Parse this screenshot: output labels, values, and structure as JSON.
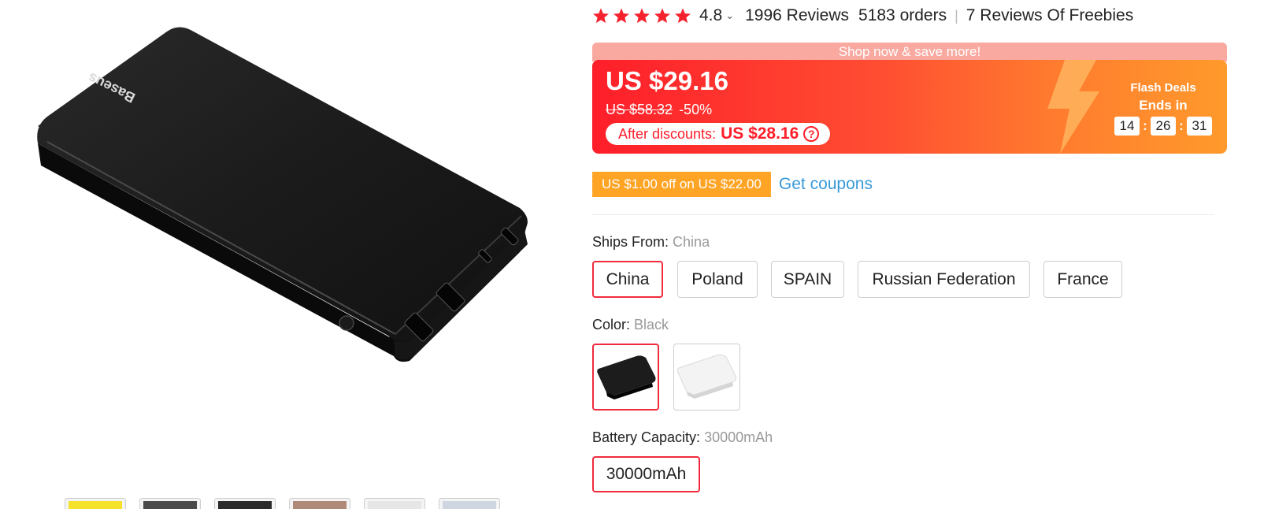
{
  "product": {
    "brand_logo_text": "Baseus",
    "rating": "4.8",
    "reviews": "1996 Reviews",
    "orders": "5183 orders",
    "freebies": "7 Reviews Of Freebies"
  },
  "banner": {
    "top_text": "Shop now & save more!",
    "price": "US $29.16",
    "original_price": "US $58.32",
    "discount": "-50%",
    "after_discounts_label": "After discounts:",
    "after_discounts_price": "US $28.16",
    "help_glyph": "?",
    "flash_title": "Flash Deals",
    "ends_in": "Ends in",
    "timer": {
      "hours": "14",
      "minutes": "26",
      "seconds": "31",
      "sep": ":"
    }
  },
  "coupon": {
    "label": "US $1.00 off on US $22.00",
    "link": "Get coupons"
  },
  "ships_from": {
    "label": "Ships From:",
    "value": "China",
    "options": [
      "China",
      "Poland",
      "SPAIN",
      "Russian Federation",
      "France"
    ],
    "selected": "China"
  },
  "color": {
    "label": "Color:",
    "value": "Black",
    "options": [
      "Black",
      "White"
    ],
    "selected": "Black"
  },
  "battery": {
    "label": "Battery Capacity:",
    "value": "30000mAh",
    "options": [
      "30000mAh"
    ]
  },
  "gallery": {
    "thumbnail_count": 6
  },
  "colors": {
    "accent_red": "#fe1e2a",
    "selected_border": "#f22a3d",
    "coupon_orange": "#ffa425",
    "link_blue": "#3a9ad8",
    "star_red": "#f5222d"
  },
  "icons": [
    "star-icon",
    "chevron-down-icon",
    "help-circle-icon",
    "lightning-bolt-icon"
  ]
}
